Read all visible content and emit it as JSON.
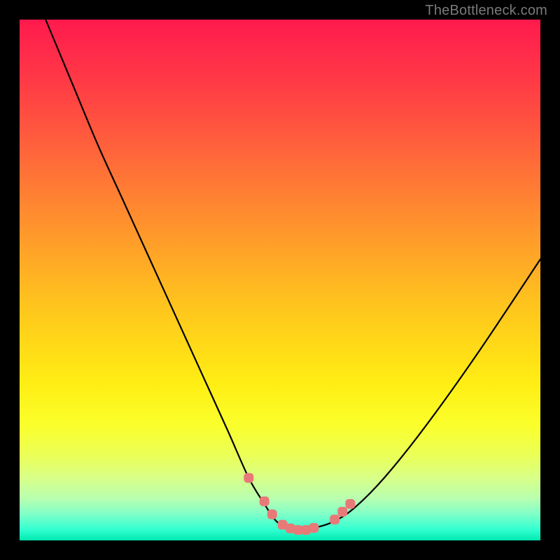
{
  "watermark": "TheBottleneck.com",
  "colors": {
    "gradient_top": "#ff1a4d",
    "gradient_mid": "#ffd818",
    "gradient_bottom": "#00e8b0",
    "curve": "#000000",
    "markers": "#e77a78",
    "frame": "#000000"
  },
  "chart_data": {
    "type": "line",
    "title": "",
    "xlabel": "",
    "ylabel": "",
    "xlim": [
      0,
      100
    ],
    "ylim": [
      0,
      100
    ],
    "grid": false,
    "legend": false,
    "annotations": [],
    "series": [
      {
        "name": "bottleneck-curve",
        "color": "#000000",
        "x": [
          5,
          10,
          15,
          20,
          25,
          30,
          35,
          40,
          44,
          47,
          49,
          51,
          53,
          55,
          57,
          60,
          64,
          70,
          78,
          88,
          100
        ],
        "y": [
          100,
          88,
          76,
          65,
          54,
          43,
          32,
          21,
          12,
          7,
          4,
          2.5,
          2,
          2,
          2.5,
          3.5,
          6,
          12,
          22,
          36,
          54
        ]
      }
    ],
    "markers": [
      {
        "name": "left-cluster-1",
        "x": 44.0,
        "y": 12.0
      },
      {
        "name": "left-cluster-2",
        "x": 47.0,
        "y": 7.5
      },
      {
        "name": "left-cluster-3",
        "x": 48.5,
        "y": 5.0
      },
      {
        "name": "trough-1",
        "x": 50.5,
        "y": 3.0
      },
      {
        "name": "trough-2",
        "x": 52.0,
        "y": 2.3
      },
      {
        "name": "trough-3",
        "x": 53.5,
        "y": 2.0
      },
      {
        "name": "trough-4",
        "x": 55.0,
        "y": 2.0
      },
      {
        "name": "trough-5",
        "x": 56.5,
        "y": 2.4
      },
      {
        "name": "right-cluster-1",
        "x": 60.5,
        "y": 4.0
      },
      {
        "name": "right-cluster-2",
        "x": 62.0,
        "y": 5.5
      },
      {
        "name": "right-cluster-3",
        "x": 63.5,
        "y": 7.0
      }
    ]
  }
}
